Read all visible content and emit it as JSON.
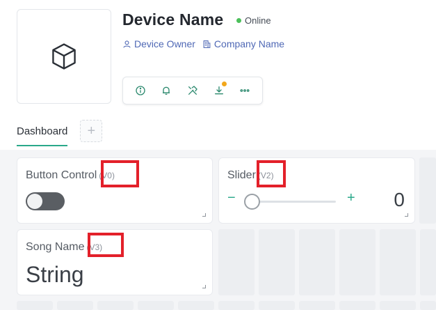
{
  "device": {
    "name": "Device Name",
    "status": "Online",
    "owner": "Device Owner",
    "company": "Company Name"
  },
  "tabs": {
    "dashboard": "Dashboard",
    "add": "+"
  },
  "widgets": {
    "button_control": {
      "label": "Button Control",
      "pin": "(V0)",
      "state": "off"
    },
    "slider": {
      "label": "Slider",
      "pin": "(V2)",
      "value": "0",
      "minus": "−",
      "plus": "+",
      "level": 0
    },
    "song_name": {
      "label": "Song Name",
      "pin": "(V3)",
      "value": "String"
    }
  },
  "icons": {
    "device": "cube-icon",
    "owner": "user-icon",
    "company": "building-icon",
    "info": "info-icon",
    "notifications": "bell-icon",
    "tools": "tools-icon",
    "download": "download-icon",
    "more": "more-icon"
  },
  "colors": {
    "accent": "#2aa88a",
    "link": "#4f68b5",
    "online": "#4cc05a",
    "badge": "#f2a71b",
    "highlight": "#e3202a"
  }
}
